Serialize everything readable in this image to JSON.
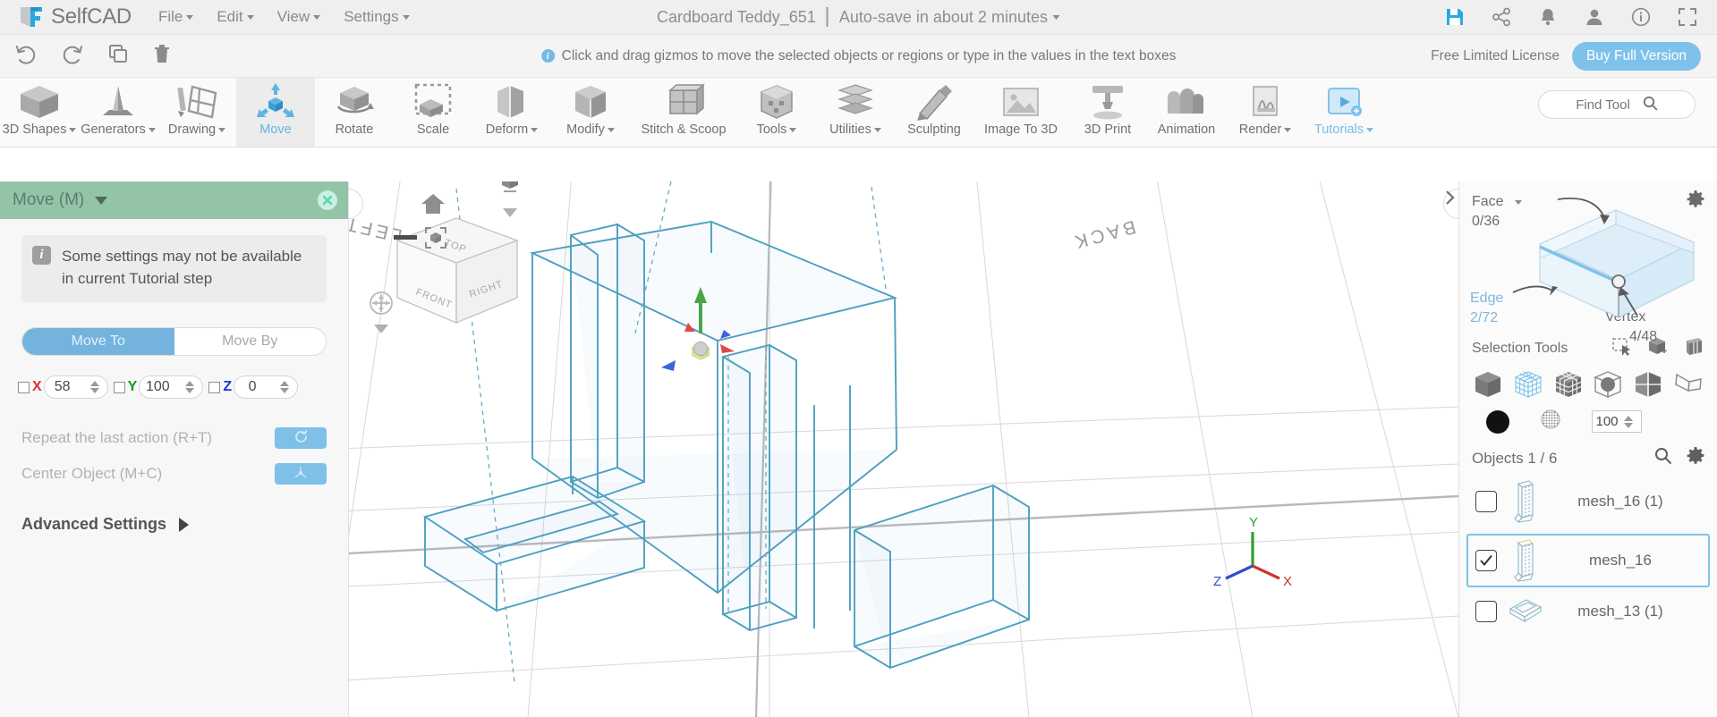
{
  "app": {
    "brand": "SelfCAD",
    "menus": [
      {
        "label": "File",
        "caret": true
      },
      {
        "label": "Edit",
        "caret": true
      },
      {
        "label": "View",
        "caret": true
      },
      {
        "label": "Settings",
        "caret": true
      }
    ],
    "document_title": "Cardboard Teddy_651",
    "autosave": "Auto-save in about 2 minutes",
    "top_icons": [
      "save-icon",
      "share-icon",
      "bell-icon",
      "user-icon",
      "info-icon",
      "fullscreen-icon"
    ]
  },
  "actionbar": {
    "undo": "undo-icon",
    "redo": "redo-icon",
    "copy": "copy-icon",
    "delete": "trash-icon",
    "hint": "Click and drag gizmos to move the selected objects or regions or type in the values in the text boxes",
    "license_text": "Free Limited License",
    "buy_label": "Buy Full Version"
  },
  "ribbon": {
    "tools": [
      {
        "label": "3D Shapes",
        "icon": "cube-icon",
        "caret": true,
        "active": false
      },
      {
        "label": "Generators",
        "icon": "cone-icon",
        "caret": true,
        "active": false
      },
      {
        "label": "Drawing",
        "icon": "pencil-sketch-icon",
        "caret": false,
        "active": false
      },
      {
        "label": "Move",
        "icon": "move-arrows-icon",
        "caret": false,
        "active": true
      },
      {
        "label": "Rotate",
        "icon": "rotate-icon",
        "caret": false,
        "active": false
      },
      {
        "label": "Scale",
        "icon": "scale-icon",
        "caret": false,
        "active": false
      },
      {
        "label": "Deform",
        "icon": "deform-icon",
        "caret": true,
        "active": false
      },
      {
        "label": "Modify",
        "icon": "modify-icon",
        "caret": true,
        "active": false
      },
      {
        "label": "Stitch & Scoop",
        "icon": "stitch-scoop-icon",
        "caret": false,
        "active": false
      },
      {
        "label": "Tools",
        "icon": "tools-icon",
        "caret": true,
        "active": false
      },
      {
        "label": "Utilities",
        "icon": "utilities-icon",
        "caret": true,
        "active": false
      },
      {
        "label": "Sculpting",
        "icon": "sculpting-icon",
        "caret": false,
        "active": false
      },
      {
        "label": "Image To 3D",
        "icon": "image-to-3d-icon",
        "caret": false,
        "active": false
      },
      {
        "label": "3D Print",
        "icon": "3d-print-icon",
        "caret": false,
        "active": false
      },
      {
        "label": "Animation",
        "icon": "animation-icon",
        "caret": false,
        "active": false
      },
      {
        "label": "Render",
        "icon": "render-icon",
        "caret": true,
        "active": false
      },
      {
        "label": "Tutorials",
        "icon": "tutorials-icon",
        "caret": true,
        "active": false
      }
    ],
    "find_tool_placeholder": "Find Tool",
    "find_tool_icon": "search-icon"
  },
  "left_panel": {
    "title": "Move (M)",
    "close_icon": "close-icon",
    "note_icon": "info-icon",
    "note": "Some settings may not be available in current Tutorial step",
    "segments": [
      {
        "label": "Move To",
        "selected": true
      },
      {
        "label": "Move By",
        "selected": false
      }
    ],
    "axes": [
      {
        "label": "X",
        "value": "58",
        "checked": false,
        "color": "#e03131"
      },
      {
        "label": "Y",
        "value": "100",
        "checked": false,
        "color": "#179c17"
      },
      {
        "label": "Z",
        "value": "0",
        "checked": false,
        "color": "#2233dd"
      }
    ],
    "repeat_label": "Repeat the last action (R+T)",
    "repeat_icon": "refresh-icon",
    "center_label": "Center Object (M+C)",
    "center_icon": "center-axis-icon",
    "advanced_label": "Advanced Settings",
    "advanced_icon": "triangle-right-icon"
  },
  "viewport": {
    "home_icon": "home-icon",
    "fit_icon": "fit-to-view-icon",
    "pan_icon": "pan-icon",
    "viewcube_icon": "view-cube-icon",
    "collapse_left_icon": "chevron-left-icon",
    "collapse_right_icon": "chevron-right-icon",
    "cube_faces": {
      "top": "TOP",
      "front": "FRONT",
      "right": "RIGHT",
      "left": "LEFT"
    },
    "ground_labels": {
      "left": "LEFT",
      "back": "BACK"
    },
    "axis_gizmo": {
      "x": "X",
      "y": "Y",
      "z": "Z"
    }
  },
  "right_panel": {
    "gear_icon": "gear-icon",
    "selection_mode": {
      "face_label": "Face",
      "face_count": "0/36",
      "edge_label": "Edge",
      "edge_count": "2/72",
      "vertex_label": "Vertex",
      "vertex_count": "4/48",
      "dropdown_icon": "chevron-down-icon"
    },
    "selection_tools_label": "Selection Tools",
    "selection_tools_top_icons": [
      "rect-select-icon",
      "add-select-icon",
      "loop-select-icon"
    ],
    "selection_tools_icons": [
      "solid-cube-icon",
      "wireframe-cube-icon",
      "subdivided-cube-icon",
      "cube-sphere-icon",
      "half-cube-icon",
      "flat-plane-icon"
    ],
    "selection_tools_active_index": 1,
    "color_swatch": "#111111",
    "color_swatch_icon": "color-circle-icon",
    "texture_icon": "texture-sphere-icon",
    "opacity_value": "100",
    "objects_label": "Objects 1 / 6",
    "objects_search_icon": "search-icon",
    "objects_gear_icon": "gear-icon",
    "objects": [
      {
        "name": "mesh_16 (1)",
        "checked": false,
        "selected": false,
        "thumb": "tall-prism-thumb"
      },
      {
        "name": "mesh_16",
        "checked": true,
        "selected": true,
        "thumb": "tall-prism-thumb"
      },
      {
        "name": "mesh_13 (1)",
        "checked": false,
        "selected": false,
        "thumb": "flat-box-thumb"
      }
    ]
  },
  "colors": {
    "accent_blue": "#7fc2ea",
    "panel_green": "#93c4a8",
    "wire_blue": "#4d9fc0"
  }
}
